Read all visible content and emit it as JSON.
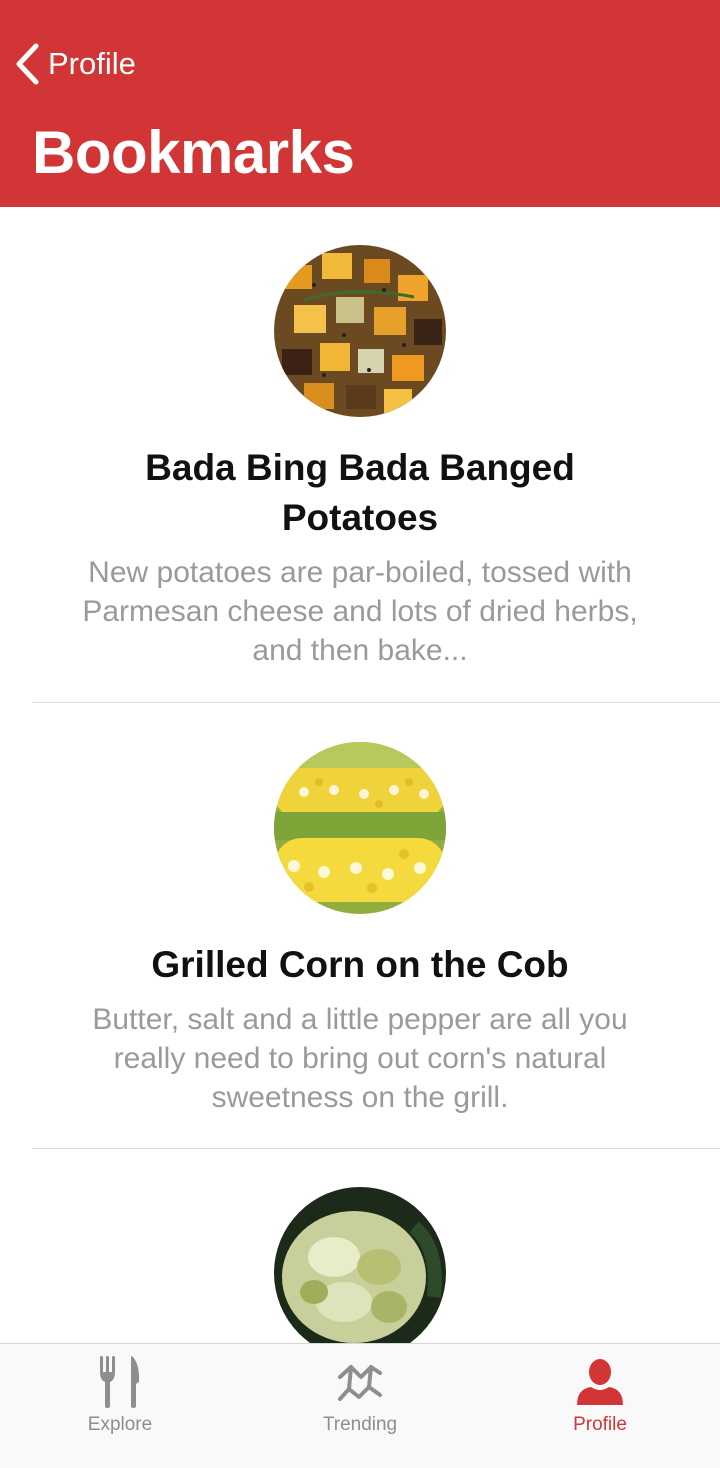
{
  "header": {
    "back_label": "Profile",
    "title": "Bookmarks",
    "color": "#d13535"
  },
  "bookmarks": [
    {
      "title": "Bada Bing Bada Banged Potatoes",
      "description": "New potatoes are par-boiled, tossed with Parmesan cheese and lots of dried herbs, and then bake...",
      "image": "roasted-potatoes-photo"
    },
    {
      "title": "Grilled Corn on the Cob",
      "description": "Butter, salt and a little pepper are all you really need to bring out corn's natural sweetness on the grill.",
      "image": "corn-on-the-cob-photo"
    },
    {
      "title": "",
      "description": "",
      "image": "egg-salad-photo"
    }
  ],
  "tabbar": {
    "tabs": [
      {
        "label": "Explore",
        "icon": "fork-knife-icon",
        "active": false
      },
      {
        "label": "Trending",
        "icon": "trending-icon",
        "active": false
      },
      {
        "label": "Profile",
        "icon": "person-icon",
        "active": true
      }
    ],
    "active_color": "#d13535",
    "inactive_color": "#8e8e8e"
  }
}
